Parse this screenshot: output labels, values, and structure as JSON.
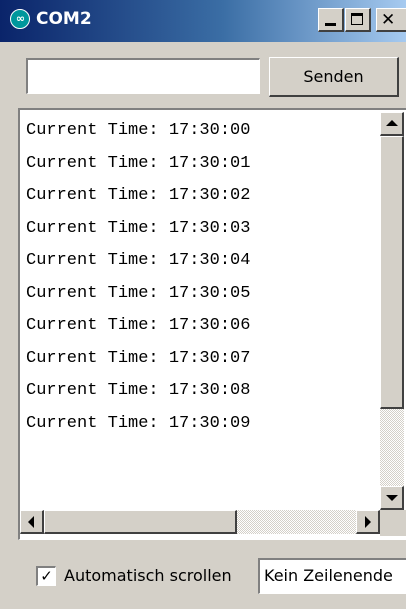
{
  "window": {
    "title": "COM2",
    "icon": "arduino-icon",
    "icon_glyph": "∞",
    "close_glyph": "✕"
  },
  "send_row": {
    "input_value": "",
    "send_label": "Senden"
  },
  "output": {
    "lines": [
      "Current Time: 17:30:00",
      "Current Time: 17:30:01",
      "Current Time: 17:30:02",
      "Current Time: 17:30:03",
      "Current Time: 17:30:04",
      "Current Time: 17:30:05",
      "Current Time: 17:30:06",
      "Current Time: 17:30:07",
      "Current Time: 17:30:08",
      "Current Time: 17:30:09"
    ]
  },
  "scroll": {
    "vertical_thumb_start": 0.0,
    "vertical_thumb_fraction": 0.78,
    "horizontal_thumb_start": 0.0,
    "horizontal_thumb_fraction": 0.62
  },
  "footer": {
    "autoscroll_checked": true,
    "check_glyph": "✓",
    "autoscroll_label": "Automatisch scrollen",
    "line_ending_value": "Kein Zeilenende"
  },
  "colors": {
    "titlebar_start": "#0a246a",
    "titlebar_end": "#a6caf0",
    "window_face": "#d4d0c8",
    "arduino_teal": "#00979c"
  }
}
